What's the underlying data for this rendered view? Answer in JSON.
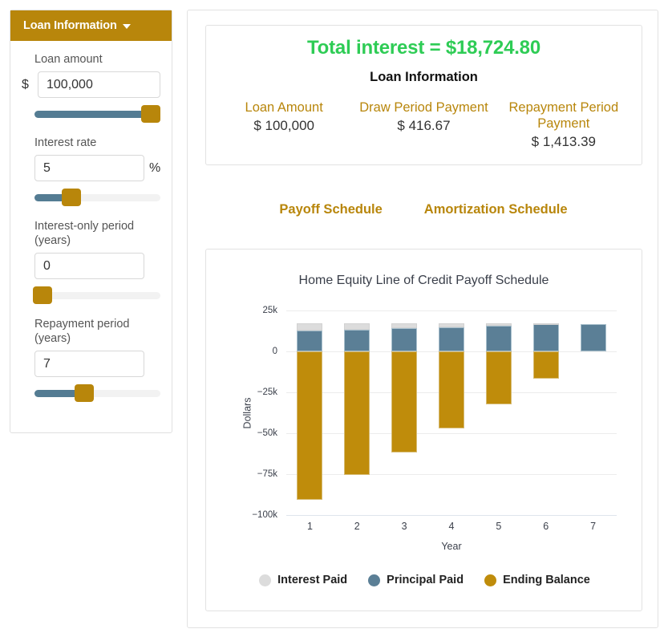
{
  "sidebar": {
    "header": {
      "title": "Loan Information",
      "icon": "chevron-down-icon"
    },
    "fields": [
      {
        "label": "Loan amount",
        "prefix": "$",
        "suffix": "",
        "value": "100,000",
        "placeholder": "",
        "slider_percent": 88
      },
      {
        "label": "Interest rate",
        "prefix": "",
        "suffix": "%",
        "value": "5",
        "placeholder": "",
        "slider_percent": 22
      },
      {
        "label": "Interest-only period (years)",
        "prefix": "",
        "suffix": "",
        "value": "0",
        "placeholder": "",
        "slider_percent": 0
      },
      {
        "label": "Repayment period (years)",
        "prefix": "",
        "suffix": "",
        "value": "7",
        "placeholder": "",
        "slider_percent": 33
      }
    ]
  },
  "summary": {
    "total_interest": "Total interest = $18,724.80",
    "subtitle": "Loan Information",
    "stats": [
      {
        "label": "Loan Amount",
        "value": "$ 100,000"
      },
      {
        "label": "Draw Period Payment",
        "value": "$ 416.67"
      },
      {
        "label": "Repayment Period Payment",
        "value": "$ 1,413.39"
      }
    ]
  },
  "tabs": [
    {
      "label": "Payoff Schedule"
    },
    {
      "label": "Amortization Schedule"
    }
  ],
  "colors": {
    "brand_gold": "#b8860b",
    "slider_blue": "#547c93",
    "total_interest_green": "#2ecc55",
    "interest_paid": "#dcdcdc",
    "principal_paid": "#5b7f96",
    "ending_balance": "#bf8c0b"
  },
  "chart_data": {
    "type": "bar",
    "title": "Home Equity Line of Credit Payoff Schedule",
    "xlabel": "Year",
    "ylabel": "Dollars",
    "categories": [
      "1",
      "2",
      "3",
      "4",
      "5",
      "6",
      "7"
    ],
    "ylim": [
      -100000,
      25000
    ],
    "yticks": [
      25000,
      0,
      -25000,
      -50000,
      -75000,
      -100000
    ],
    "ytick_labels": [
      "25k",
      "0",
      "−25k",
      "−50k",
      "−75k",
      "−100k"
    ],
    "grid": true,
    "legend_position": "bottom",
    "stacked": true,
    "series": [
      {
        "name": "Interest Paid",
        "color": "#dcdcdc",
        "values": [
          4432,
          3690,
          2914,
          2102,
          1253,
          364,
          0
        ]
      },
      {
        "name": "Principal Paid",
        "color": "#5b7f96",
        "values": [
          12527,
          13269,
          14045,
          14857,
          15707,
          16595,
          16798
        ]
      },
      {
        "name": "Ending Balance",
        "color": "#bf8c0b",
        "values": [
          -90600,
          -75500,
          -62000,
          -47000,
          -32500,
          -16800,
          0
        ]
      }
    ]
  }
}
